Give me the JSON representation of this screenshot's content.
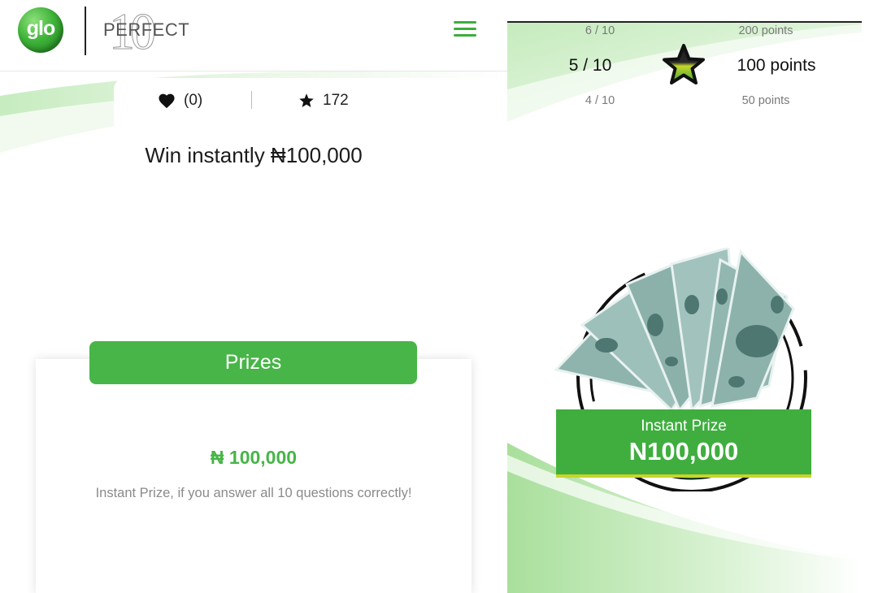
{
  "header": {
    "glo_logo_text": "glo",
    "perfect_logo_text": "PERFECT",
    "perfect_logo_number": "10"
  },
  "stats": {
    "likes": "(0)",
    "stars": "172"
  },
  "headline": "Win instantly ₦100,000",
  "prizes": {
    "button_label": "Prizes",
    "amount": "₦ 100,000",
    "description": "Instant Prize, if you answer all 10 questions correctly!"
  },
  "points_ladder": {
    "rows": [
      {
        "level": "6 / 10",
        "points": "200 points"
      },
      {
        "level": "5 / 10",
        "points": "100 points"
      },
      {
        "level": "4 / 10",
        "points": "50 points"
      }
    ]
  },
  "instant_prize": {
    "label": "Instant Prize",
    "amount": "N100,000"
  },
  "colors": {
    "brand_green": "#47b547",
    "dark_green": "#1f7d1c",
    "accent_yellow": "#c8d42a"
  },
  "icons": [
    "glo-logo-icon",
    "hamburger-menu-icon",
    "heart-icon",
    "star-icon",
    "star-badge-icon",
    "money-bills-icon"
  ]
}
